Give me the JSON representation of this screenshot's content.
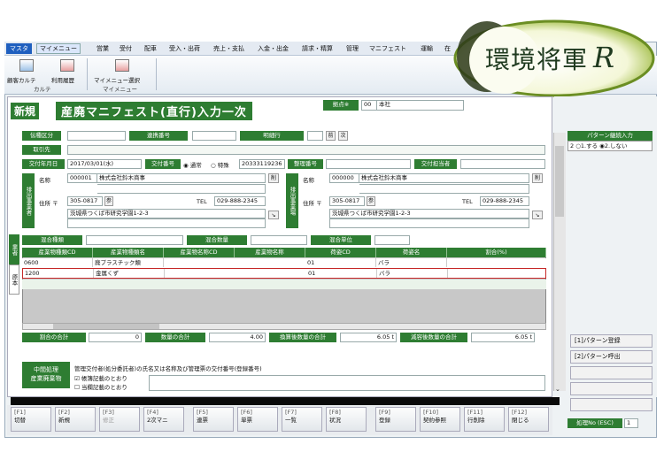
{
  "menu": [
    "マスタ",
    "マイメニュー",
    "営業",
    "受付",
    "配車",
    "受入・出荷",
    "売上・支払",
    "入金・出金",
    "請求・精算",
    "管理",
    "マニフェスト",
    "運輸",
    "在"
  ],
  "ribbon": [
    {
      "label": "顧客カルテ"
    },
    {
      "label": "利用履歴"
    },
    {
      "label": "カルテ"
    },
    {
      "label": "マイメニュー選択"
    },
    {
      "label": "マイメニュー"
    }
  ],
  "logo": {
    "text": "環境将軍",
    "r": "R"
  },
  "header": {
    "mode": "新規",
    "title": "産廃マニフェスト(直行)入力一次",
    "base_label": "拠点※",
    "base_code": "00",
    "base_name": "本社"
  },
  "form": {
    "denpyo_label": "伝種区分",
    "renkei_label": "連携番号",
    "meisai_label": "明細行",
    "prev": "前",
    "next": "次",
    "torihiki_label": "取引先",
    "kofu_date_label": "交付年月日",
    "kofu_date": "2017/03/01(水)",
    "kofu_no_label": "交付番号",
    "radio_normal": "通常",
    "radio_special": "特殊",
    "kofu_no": "20333119236",
    "seiri_label": "整理番号",
    "tanto_label": "交付担当者",
    "haishutsu_side": "排出事業者",
    "haishutsu_jigyo": "排出事業場",
    "name_label": "名称",
    "del": "削",
    "left": {
      "code": "000001",
      "name": "株式会社鈴木商事",
      "zip": "305-0817",
      "tel": "029-888-2345",
      "addr": "茨城県つくば市研究学園1-2-3"
    },
    "right": {
      "code": "000000",
      "name": "株式会社鈴木商事",
      "zip": "305-0817",
      "tel": "029-888-2345",
      "addr": "茨城県つくば市研究学園1-2-3"
    },
    "addr_label": "住所 〒",
    "tel_label": "TEL",
    "ref": "参",
    "konbo_label": "混合種類",
    "konbo_qty_label": "混合数量",
    "konbo_unit_label": "混合単位"
  },
  "tabs": [
    "業者",
    "原本"
  ],
  "table": {
    "headers": [
      "産業物種類CD",
      "産業物種類名",
      "産業物名称CD",
      "産業物名称",
      "荷姿CD",
      "荷姿名",
      "割合(%)"
    ],
    "rows": [
      [
        "0600",
        "廃プラスチック類",
        "",
        "",
        "01",
        "バラ",
        ""
      ],
      [
        "1200",
        "金属くず",
        "",
        "",
        "01",
        "バラ",
        ""
      ]
    ]
  },
  "totals": {
    "ratio_label": "割合の合計",
    "ratio": "0",
    "qty_label": "数量の合計",
    "qty": "4.00",
    "conv_label": "換算後数量の合計",
    "conv": "6.05 t",
    "reduced_label": "減容後数量の合計",
    "reduced": "6.05 t"
  },
  "middle": {
    "label1": "中間処理",
    "label2": "産業廃棄物",
    "desc": "管理交付者(処分委託者)の氏名又は名称及び管理票の交付番号(登録番号)",
    "opt1": "帳簿記載のとおり",
    "opt2": "当欄記載のとおり"
  },
  "pattern": {
    "title": "パターン継続入力",
    "val": "2",
    "opt1": "1.する",
    "opt2": "2.しない",
    "reg": "[1]パターン登録",
    "call": "[2]パターン呼出"
  },
  "fkeys": [
    [
      "[F1]",
      "切替"
    ],
    [
      "[F2]",
      "新規"
    ],
    [
      "[F3]",
      "修正"
    ],
    [
      "[F4]",
      "2次マニ"
    ],
    [
      "[F5]",
      "連票"
    ],
    [
      "[F6]",
      "単票"
    ],
    [
      "[F7]",
      "一覧"
    ],
    [
      "[F8]",
      "状況"
    ],
    [
      "[F9]",
      "登録"
    ],
    [
      "[F10]",
      "契約参照"
    ],
    [
      "[F11]",
      "行削除"
    ],
    [
      "[F12]",
      "閉じる"
    ]
  ],
  "shori": {
    "label": "処理No (ESC)",
    "val": "1"
  }
}
